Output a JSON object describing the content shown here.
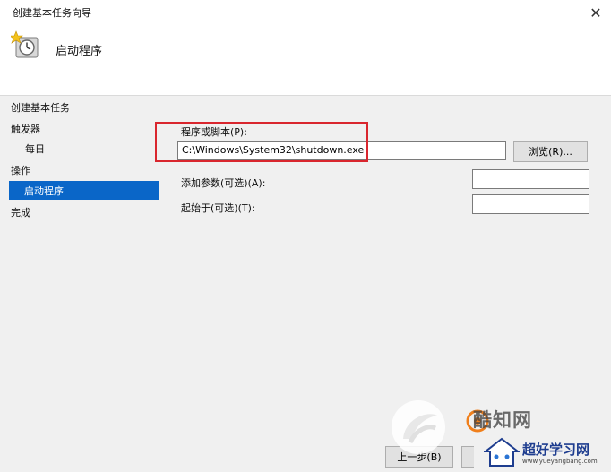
{
  "window": {
    "title": "创建基本任务向导",
    "close_glyph": "✕"
  },
  "header": {
    "title": "启动程序",
    "icon": "task-scheduler-clock-icon"
  },
  "sidebar": {
    "items": [
      {
        "label": "创建基本任务",
        "selected": false
      },
      {
        "label": "触发器",
        "selected": false
      },
      {
        "label": "每日",
        "selected": false
      },
      {
        "label": "操作",
        "selected": false
      },
      {
        "label": "启动程序",
        "selected": true
      },
      {
        "label": "完成",
        "selected": false
      }
    ]
  },
  "form": {
    "program_label": "程序或脚本(P):",
    "program_value": "C:\\Windows\\System32\\shutdown.exe",
    "browse_label": "浏览(R)...",
    "args_label": "添加参数(可选)(A):",
    "args_value": "",
    "start_in_label": "起始于(可选)(T):",
    "start_in_value": ""
  },
  "footer": {
    "back_label": "上一步(B)"
  },
  "watermark": {
    "brand1": "酷知网",
    "brand2": "超好学习网",
    "url": "www.yueyangbang.com"
  },
  "colors": {
    "selection": "#0a66c8",
    "highlight_border": "#d9262e",
    "window_bg": "#f0f0f0"
  }
}
